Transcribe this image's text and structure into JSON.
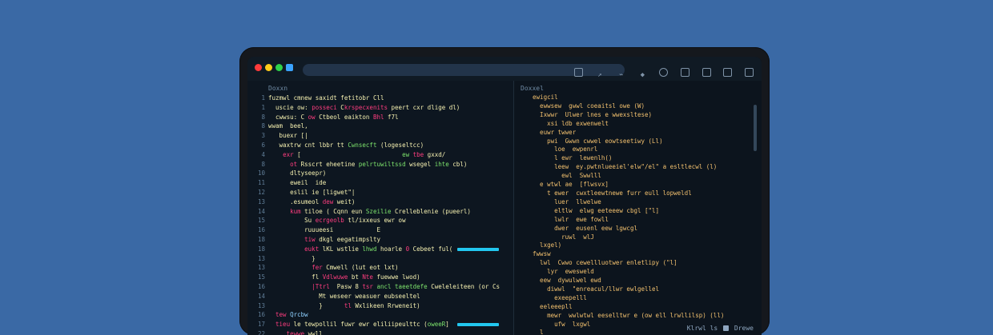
{
  "toolbar": {
    "icons": [
      "panel-icon",
      "branch-icon",
      "link-icon",
      "tag-icon",
      "circle-icon",
      "doc-icon",
      "file-icon",
      "grid-icon",
      "box-icon"
    ]
  },
  "editor": {
    "title": "Doxxn",
    "line_numbers": [
      "1",
      "1",
      "8",
      "8",
      "3",
      "6",
      "4",
      "8",
      "10",
      "11",
      "12",
      "13",
      "14",
      "15",
      "16",
      "18",
      "18",
      "13",
      "13",
      "15",
      "16",
      "14",
      "13",
      "16",
      "17",
      "22",
      "23"
    ],
    "lines": [
      [
        {
          "t": "fuzmwl cmnew saxidt fetitobr Cll",
          "c": "st"
        }
      ],
      [
        {
          "t": "  uscie ow: ",
          "c": "st"
        },
        {
          "t": "posseci",
          "c": "kw"
        },
        {
          "t": " C",
          "c": "st"
        },
        {
          "t": "krspecxenits",
          "c": "kw"
        },
        {
          "t": " peert cxr dlige dl)",
          "c": "st"
        }
      ],
      [
        {
          "t": "  cwwsu: C ",
          "c": "st"
        },
        {
          "t": "ow",
          "c": "kw"
        },
        {
          "t": " Ctbeol eaikton ",
          "c": "st"
        },
        {
          "t": "Bhl",
          "c": "kw"
        },
        {
          "t": " f7l",
          "c": "st"
        }
      ],
      [
        {
          "t": "wwam  beel,",
          "c": "st"
        }
      ],
      [
        {
          "t": "   buexr [|",
          "c": "st"
        }
      ],
      [
        {
          "t": "   waxtrw cnt lbbr tt ",
          "c": "st"
        },
        {
          "t": "Cwnsecft",
          "c": "fn"
        },
        {
          "t": " (logeseltcc)",
          "c": "st"
        }
      ],
      [
        {
          "t": "    ",
          "c": "st"
        },
        {
          "t": "exr",
          "c": "kw"
        },
        {
          "t": " [                            ",
          "c": "st"
        },
        {
          "t": "ew",
          "c": "fn"
        },
        {
          "t": " ",
          "c": "st"
        },
        {
          "t": "tbe",
          "c": "kw"
        },
        {
          "t": " gxxd/",
          "c": "st"
        }
      ],
      [
        {
          "t": "      ",
          "c": "st"
        },
        {
          "t": "ot",
          "c": "kw"
        },
        {
          "t": " Rsscrt eheetine ",
          "c": "st"
        },
        {
          "t": "pelrtuwiltssd",
          "c": "fn"
        },
        {
          "t": " wsegel ",
          "c": "st"
        },
        {
          "t": "ihte",
          "c": "fn"
        },
        {
          "t": " cbl)",
          "c": "st"
        }
      ],
      [
        {
          "t": "      dltyseepr)",
          "c": "st"
        }
      ],
      [
        {
          "t": "      eweil  ide",
          "c": "st"
        }
      ],
      [
        {
          "t": "      eslil ie [ligwet\"|",
          "c": "st"
        }
      ],
      [
        {
          "t": "      .esumeol ",
          "c": "st"
        },
        {
          "t": "dew",
          "c": "kw"
        },
        {
          "t": " weit)",
          "c": "st"
        }
      ],
      [
        {
          "t": "      ",
          "c": "st"
        },
        {
          "t": "kum",
          "c": "kw"
        },
        {
          "t": " tiloe ( ",
          "c": "st"
        },
        {
          "t": "Cqnn",
          "c": "st"
        },
        {
          "t": " eun ",
          "c": "st"
        },
        {
          "t": "Szeilie",
          "c": "fn"
        },
        {
          "t": " Crelleblenie (pueerl)",
          "c": "st"
        }
      ],
      [
        {
          "t": "          Su ",
          "c": "st"
        },
        {
          "t": "ecrgeolb",
          "c": "kw"
        },
        {
          "t": " tl/ixxeus ewr ow",
          "c": "st"
        }
      ],
      [
        {
          "t": "          ruuueesi            E",
          "c": "st"
        }
      ],
      [
        {
          "t": "          ",
          "c": "st"
        },
        {
          "t": "tiw",
          "c": "kw"
        },
        {
          "t": " dkgl eegatimpslty",
          "c": "st"
        }
      ],
      [
        {
          "t": "          ",
          "c": "st"
        },
        {
          "t": "eukt",
          "c": "kw"
        },
        {
          "t": " lKL wstlie ",
          "c": "st"
        },
        {
          "t": "lhwd",
          "c": "fn"
        },
        {
          "t": " hoarle ",
          "c": "st"
        },
        {
          "t": "0",
          "c": "kw"
        },
        {
          "t": " Cebeet ful(",
          "c": "st"
        },
        {
          "bar": "cyan",
          "l": 236,
          "w": 52
        }
      ],
      [
        {
          "t": "            }",
          "c": "st"
        }
      ],
      [
        {
          "t": "            ",
          "c": "st"
        },
        {
          "t": "fer",
          "c": "kw"
        },
        {
          "t": " Cmwell (lut eot lxt)",
          "c": "st"
        }
      ],
      [
        {
          "t": "            fl ",
          "c": "st"
        },
        {
          "t": "Vdlwuwe",
          "c": "kw"
        },
        {
          "t": " bt ",
          "c": "st"
        },
        {
          "t": "Nte",
          "c": "kw"
        },
        {
          "t": " fuewwe lwod)",
          "c": "st"
        }
      ],
      [
        {
          "t": "            ",
          "c": "st"
        },
        {
          "t": "|Ttrl",
          "c": "kw"
        },
        {
          "t": "  Pasw 8 ",
          "c": "st"
        },
        {
          "t": "tsr",
          "c": "kw"
        },
        {
          "t": " ",
          "c": "st"
        },
        {
          "t": "ancl taeetdefe",
          "c": "fn"
        },
        {
          "t": " Cweleleiteen (or Cs",
          "c": "st"
        }
      ],
      [
        {
          "t": "              Mt weseer weasuer eubseeltel",
          "c": "st"
        }
      ],
      [
        {
          "t": "              }      ",
          "c": "st"
        },
        {
          "t": "tl",
          "c": "kw"
        },
        {
          "t": " Wxlikeen Rrweneit)",
          "c": "st"
        }
      ],
      [
        {
          "t": "  ",
          "c": "st"
        },
        {
          "t": "tew",
          "c": "kw"
        },
        {
          "t": " ",
          "c": "st"
        },
        {
          "t": "Qrcbw",
          "c": "cm"
        }
      ],
      [
        {
          "t": "  ",
          "c": "st"
        },
        {
          "t": "tieu",
          "c": "kw"
        },
        {
          "t": " le ",
          "c": "st"
        },
        {
          "t": "tewpollil",
          "c": "st"
        },
        {
          "t": " ",
          "c": "st"
        },
        {
          "t": "fuwr",
          "c": "st"
        },
        {
          "t": " ewr ",
          "c": "st"
        },
        {
          "t": "eliliipeulttc",
          "c": "st"
        },
        {
          "t": " (",
          "c": "st"
        },
        {
          "t": "oweeR",
          "c": "fn"
        },
        {
          "t": "]",
          "c": "st"
        },
        {
          "bar": "cyan",
          "l": 236,
          "w": 52
        }
      ],
      [
        {
          "t": "     ",
          "c": "st"
        },
        {
          "t": "tewwe",
          "c": "kw"
        },
        {
          "t": " wwll",
          "c": "st"
        }
      ],
      [
        {
          "t": "  ",
          "c": "st"
        },
        {
          "t": "e-ueelt",
          "c": "kw"
        },
        {
          "t": " tlw Ceillenl eer eee Ull",
          "c": "st"
        },
        {
          "bar": "red",
          "l": 176,
          "w": 112
        }
      ]
    ]
  },
  "output": {
    "title": "Doxxel",
    "lines": [
      "  ewigcil",
      "    ewwsew  gwwl coeaitsl owe (W)",
      "    Ixwwr  Ulwer lnes e wwexsltese)",
      "      xsi ldb exwenwelt",
      "    euwr twwer",
      "      pwi  Gwwn cwwel eowtseetiwy (Ll)",
      "        loe  ewpenrl",
      "        l ewr  lewenlh()",
      "        leew  ey.pwtnlueeiel'elw\"/el\" a esltlecwl (l)",
      "          ewl  Swwlll",
      "    e wtwl ae  [flwsvx]",
      "      t ewer  cwxtleewtnewe furr eull lopweldl",
      "        luer  llwelwe",
      "        eltlw  elwg eeteeew cbgl [\"l]",
      "        lwlr  ewe fowll",
      "        dwer  eusenl eew lgwcgl",
      "          ruwl  wlJ",
      "    lxgel)",
      "  fwwsw",
      "    lwl  Cwwo cewellluotwer enletlipy (\"l]",
      "      lyr  ewesweld",
      "    eew  dywulwel ewd",
      "      diwwl  \"enreacul/llwr ewlgellel",
      "        exeepelll",
      "    eeleeepll",
      "      mewr  wwlwtwl eeselltwr e (ow ell lrwllilsp) (ll)",
      "        ufw  lxgwl",
      "    l"
    ]
  },
  "status": {
    "text_left": "Klrwl",
    "text_mid": "ls",
    "text_right": "Drewe"
  }
}
